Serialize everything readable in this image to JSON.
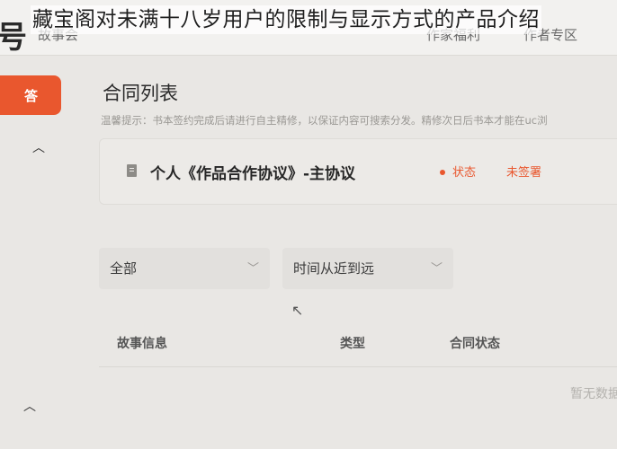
{
  "overlay_caption": "藏宝阁对未满十八岁用户的限制与显示方式的产品介绍",
  "header": {
    "logo_fragment": "号",
    "nav": [
      "故事会",
      "作家福利",
      "作者专区"
    ]
  },
  "sidebar": {
    "active_button": "答"
  },
  "main": {
    "title": "合同列表",
    "tip": "温馨提示：书本签约完成后请进行自主精修，以保证内容可搜索分发。精修次日后书本才能在uc浏",
    "contract": {
      "name": "个人《作品合作协议》-主协议",
      "status_label": "状态",
      "status_value": "未签署"
    },
    "filters": {
      "category": "全部",
      "sort": "时间从近到远"
    },
    "table": {
      "columns": [
        "故事信息",
        "类型",
        "合同状态"
      ],
      "empty_text": "暂无数据"
    }
  },
  "colors": {
    "accent": "#e9572e"
  },
  "icons": {
    "collapse": "chevron-up-icon",
    "select_arrow": "chevron-down-icon",
    "document": "document-icon",
    "cursor": "mouse-pointer-icon"
  }
}
